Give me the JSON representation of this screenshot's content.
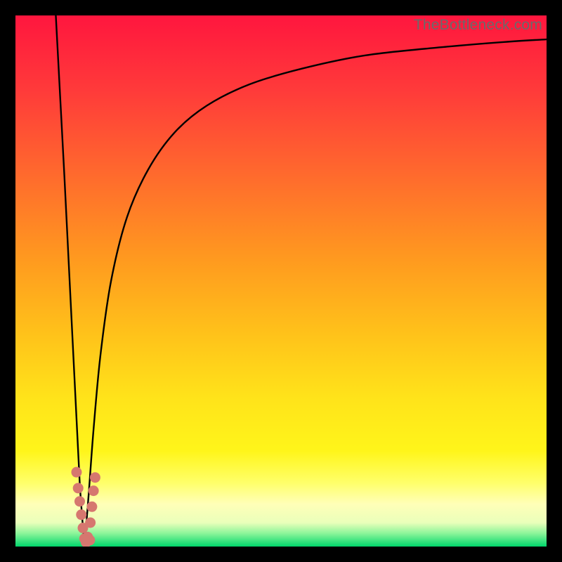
{
  "watermark": "TheBottleneck.com",
  "colors": {
    "frame": "#000000",
    "gradient_top": "#ff1a3c",
    "gradient_mid_upper": "#ff6a2d",
    "gradient_mid": "#ffb31a",
    "gradient_mid_lower": "#ffe61a",
    "gradient_pale": "#ffff9a",
    "gradient_green": "#00e673",
    "curve": "#000000",
    "dots": "#d6776f"
  },
  "chart_data": {
    "type": "line",
    "title": "",
    "xlabel": "",
    "ylabel": "",
    "xlim": [
      0,
      100
    ],
    "ylim": [
      0,
      100
    ],
    "series": [
      {
        "name": "left-branch",
        "x": [
          7.6,
          8.4,
          9.2,
          10.0,
          10.8,
          11.6,
          12.1,
          12.6,
          13.0
        ],
        "y": [
          100,
          85,
          70,
          54,
          38,
          22,
          12,
          5,
          0
        ]
      },
      {
        "name": "right-branch",
        "x": [
          13.0,
          13.8,
          14.7,
          16.0,
          18.0,
          21.0,
          25.0,
          30.0,
          36.0,
          44.0,
          54.0,
          66.0,
          80.0,
          92.0,
          100.0
        ],
        "y": [
          0,
          10,
          22,
          36,
          50,
          62,
          71,
          78,
          83,
          87,
          90,
          92.5,
          94,
          95,
          95.5
        ]
      }
    ],
    "scatter": {
      "name": "dots",
      "points": [
        {
          "x": 11.5,
          "y": 14.0
        },
        {
          "x": 11.8,
          "y": 11.0
        },
        {
          "x": 12.1,
          "y": 8.5
        },
        {
          "x": 12.4,
          "y": 6.0
        },
        {
          "x": 12.7,
          "y": 3.5
        },
        {
          "x": 13.0,
          "y": 1.5
        },
        {
          "x": 13.6,
          "y": 1.8
        },
        {
          "x": 14.1,
          "y": 4.5
        },
        {
          "x": 14.4,
          "y": 7.5
        },
        {
          "x": 14.7,
          "y": 10.5
        },
        {
          "x": 15.0,
          "y": 13.0
        },
        {
          "x": 14.0,
          "y": 1.2
        },
        {
          "x": 13.3,
          "y": 0.8
        }
      ]
    }
  }
}
